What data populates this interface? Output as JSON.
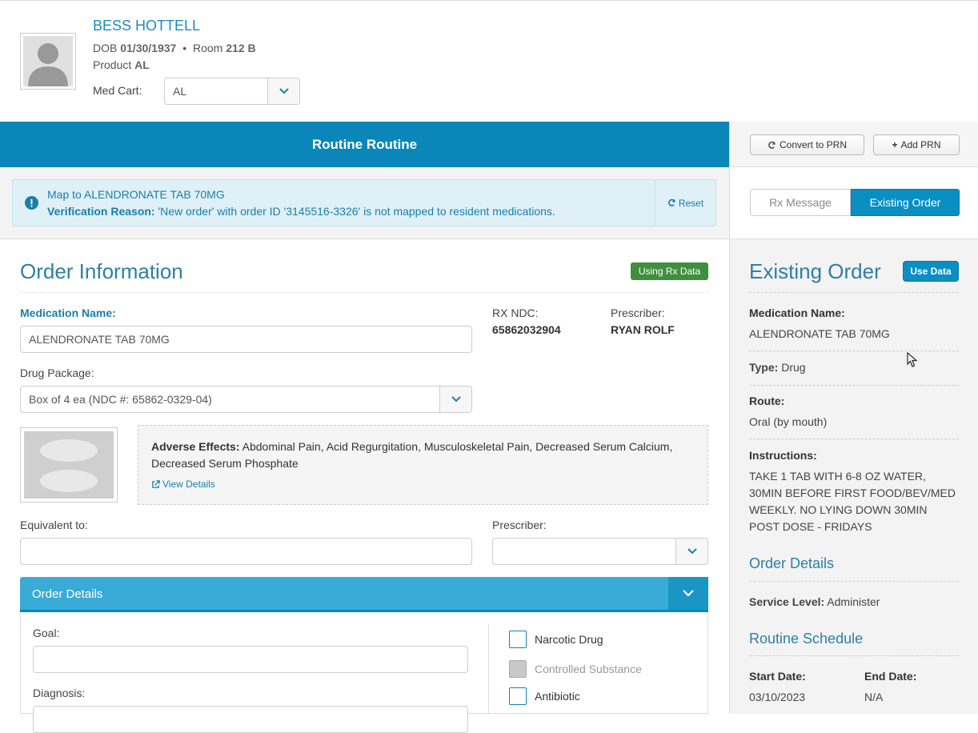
{
  "resident": {
    "name": "BESS HOTTELL",
    "dob_label": "DOB",
    "dob": "01/30/1937",
    "separator": "•",
    "room_label": "Room",
    "room": "212 B",
    "product_label": "Product",
    "product": "AL",
    "medcart_label": "Med Cart:",
    "medcart_value": "AL"
  },
  "titlebar": {
    "title": "Routine Routine"
  },
  "actions": {
    "convert_prn": "Convert to PRN",
    "add_prn": "Add PRN"
  },
  "alert": {
    "line1": "Map to ALENDRONATE TAB 70MG",
    "reason_label": "Verification Reason:",
    "reason_text": "'New order' with order ID '3145516-3326' is not mapped to resident medications.",
    "reset": "Reset"
  },
  "tabs": {
    "rx_message": "Rx Message",
    "existing_order": "Existing Order"
  },
  "order_info": {
    "title": "Order Information",
    "badge": "Using Rx Data",
    "medication_label": "Medication Name:",
    "medication_value": "ALENDRONATE TAB 70MG",
    "rx_ndc_label": "RX NDC:",
    "rx_ndc_value": "65862032904",
    "prescriber_label": "Prescriber:",
    "prescriber_value": "RYAN ROLF",
    "drug_package_label": "Drug Package:",
    "drug_package_value": "Box of 4 ea (NDC #: 65862-0329-04)",
    "adverse_label": "Adverse Effects:",
    "adverse_text": "Abdominal Pain, Acid Regurgitation, Musculoskeletal Pain, Decreased Serum Calcium, Decreased Serum Phosphate",
    "view_details": "View Details",
    "equivalent_label": "Equivalent to:",
    "equivalent_value": "",
    "prescriber2_label": "Prescriber:",
    "prescriber2_value": ""
  },
  "order_details_panel": {
    "title": "Order Details",
    "goal_label": "Goal:",
    "diagnosis_label": "Diagnosis:",
    "narcotic": "Narcotic Drug",
    "controlled": "Controlled Substance",
    "antibiotic": "Antibiotic"
  },
  "existing_order": {
    "title": "Existing Order",
    "use_data": "Use Data",
    "medication_label": "Medication Name:",
    "medication_value": "ALENDRONATE TAB 70MG",
    "type_label": "Type:",
    "type_value": "Drug",
    "route_label": "Route:",
    "route_value": "Oral (by mouth)",
    "instructions_label": "Instructions:",
    "instructions_lines": [
      "TAKE 1 TAB WITH 6-8 OZ WATER,",
      "30MIN BEFORE FIRST FOOD/BEV/MED",
      "WEEKLY. NO LYING DOWN 30MIN",
      "POST DOSE - FRIDAYS"
    ],
    "order_details_title": "Order Details",
    "service_level_label": "Service Level:",
    "service_level_value": "Administer",
    "schedule_title": "Routine Schedule",
    "start_label": "Start Date:",
    "start_value": "03/10/2023",
    "end_label": "End Date:",
    "end_value": "N/A"
  },
  "colors": {
    "primary": "#0a87b8",
    "accent_light": "#3aaad6",
    "badge_green": "#3f8f3f",
    "link": "#1a7fa8"
  }
}
